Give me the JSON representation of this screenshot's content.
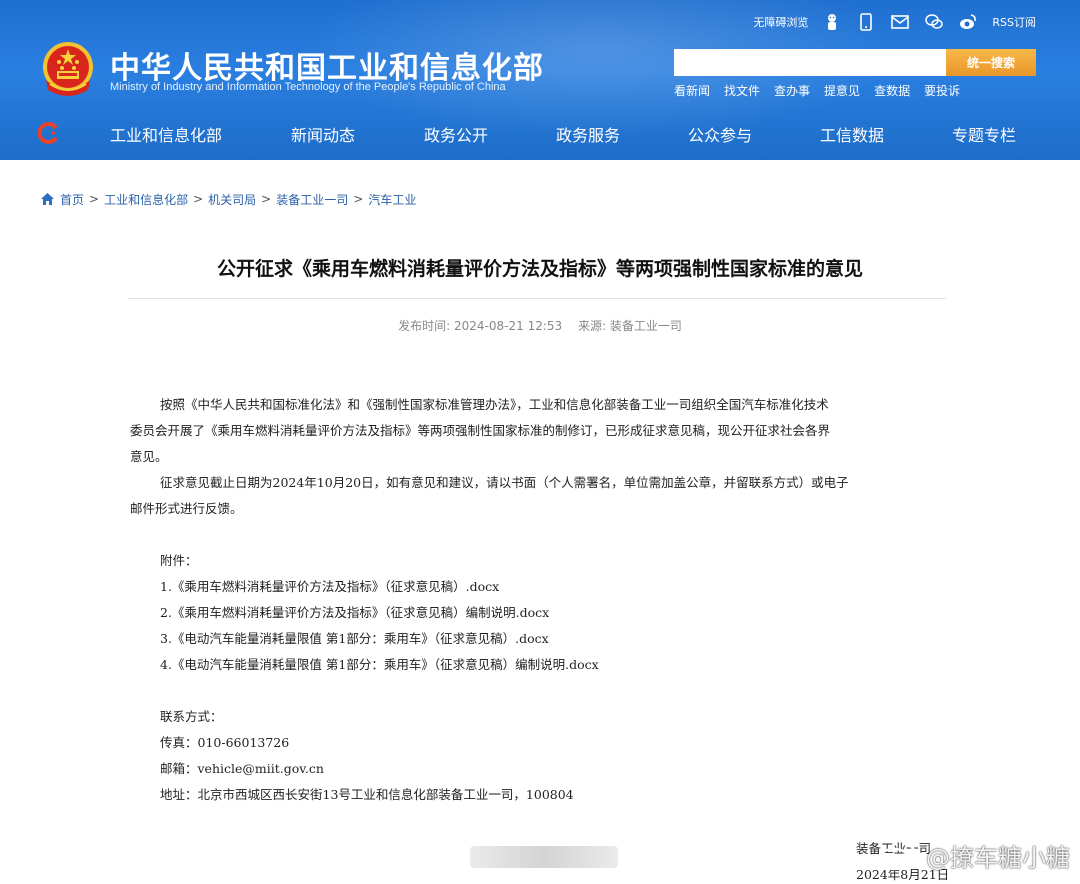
{
  "header": {
    "site_title": "中华人民共和国工业和信息化部",
    "site_subtitle": "Ministry of Industry and Information Technology of the People's Republic of China",
    "util": {
      "accessibility": "无障碍浏览",
      "rss": "RSS订阅",
      "icons": [
        "mascot-icon",
        "mobile-icon",
        "mail-icon",
        "wechat-icon",
        "weibo-icon"
      ]
    },
    "search": {
      "placeholder": "",
      "button": "统一搜索"
    },
    "quick_links": [
      "看新闻",
      "找文件",
      "查办事",
      "提意见",
      "查数据",
      "要投诉"
    ],
    "nav": [
      "工业和信息化部",
      "新闻动态",
      "政务公开",
      "政务服务",
      "公众参与",
      "工信数据",
      "专题专栏"
    ]
  },
  "breadcrumb": [
    "首页",
    "工业和信息化部",
    "机关司局",
    "装备工业一司",
    "汽车工业"
  ],
  "article": {
    "title": "公开征求《乘用车燃料消耗量评价方法及指标》等两项强制性国家标准的意见",
    "publish_label": "发布时间: 2024-08-21 12:53",
    "source_label": "来源: 装备工业一司",
    "paragraph1_lines": [
      "按照《中华人民共和国标准化法》和《强制性国家标准管理办法》，工业和信息化部装备工业一司组织全国汽车标准化技术",
      "委员会开展了《乘用车燃料消耗量评价方法及指标》等两项强制性国家标准的制修订，已形成征求意见稿，现公开征求社会各界",
      "意见。"
    ],
    "paragraph2_lines": [
      "征求意见截止日期为2024年10月20日，如有意见和建议，请以书面（个人需署名，单位需加盖公章，并留联系方式）或电子",
      "邮件形式进行反馈。"
    ],
    "attachments_label": "附件：",
    "attachments": [
      "1.《乘用车燃料消耗量评价方法及指标》（征求意见稿）.docx",
      "2.《乘用车燃料消耗量评价方法及指标》（征求意见稿）编制说明.docx",
      "3.《电动汽车能量消耗量限值 第1部分：乘用车》（征求意见稿）.docx",
      "4.《电动汽车能量消耗量限值 第1部分：乘用车》（征求意见稿）编制说明.docx"
    ],
    "contact_label": "联系方式：",
    "fax": "传真：010-66013726",
    "email": "邮箱：vehicle@miit.gov.cn",
    "address": "地址：北京市西城区西长安街13号工业和信息化部装备工业一司，100804",
    "signoff_org": "装备工业一司",
    "signoff_date": "2024年8月21日"
  },
  "watermark": "@撩车糖小糖",
  "colors": {
    "header_blue": "#2a7fe0",
    "search_orange": "#e9962a",
    "link_blue": "#2a5fa8"
  }
}
